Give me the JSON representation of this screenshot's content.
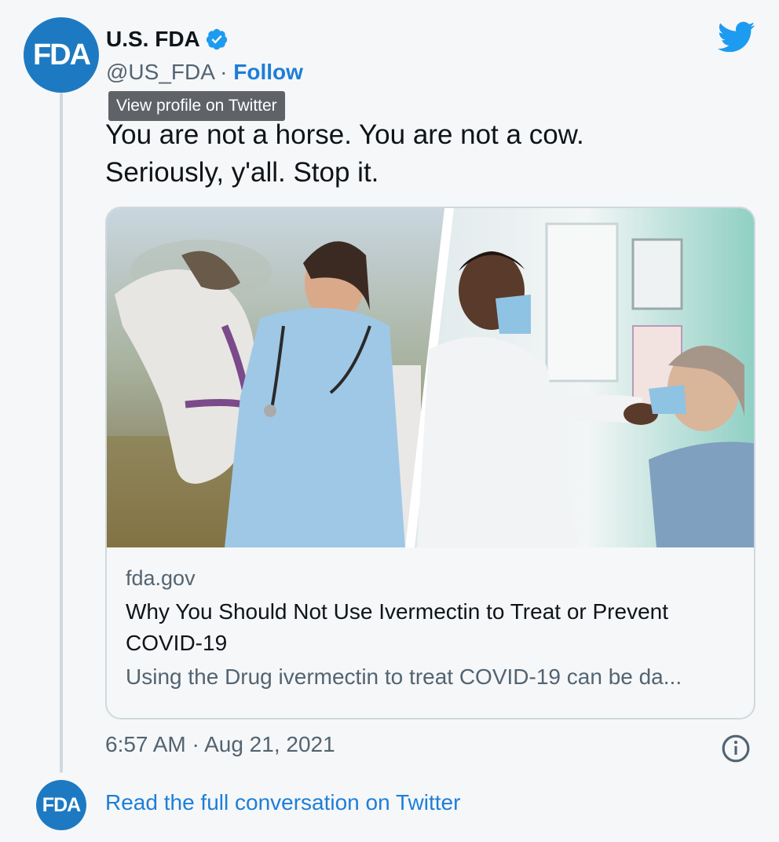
{
  "author": {
    "avatar_text": "FDA",
    "name": "U.S. FDA",
    "handle": "@US_FDA",
    "separator": " · ",
    "follow_label": "Follow",
    "verified_icon": "verified-badge-icon"
  },
  "tooltip": "View profile on Twitter",
  "tweet": {
    "line1": "You are not a horse. You are not a cow.",
    "line2": "Seriously, y'all. Stop it."
  },
  "link_card": {
    "domain": "fda.gov",
    "title": "Why You Should Not Use Ivermectin to Treat or Prevent COVID-19",
    "description": "Using the Drug ivermectin to treat COVID-19 can be da..."
  },
  "timestamp": "6:57 AM · Aug 21, 2021",
  "footer": {
    "avatar_text": "FDA",
    "read_full_label": "Read the full conversation on Twitter"
  },
  "colors": {
    "brand_blue": "#1d7ed8",
    "twitter_blue": "#1d9bf0",
    "fda_blue": "#1d7ac2",
    "secondary_text": "#536471"
  }
}
